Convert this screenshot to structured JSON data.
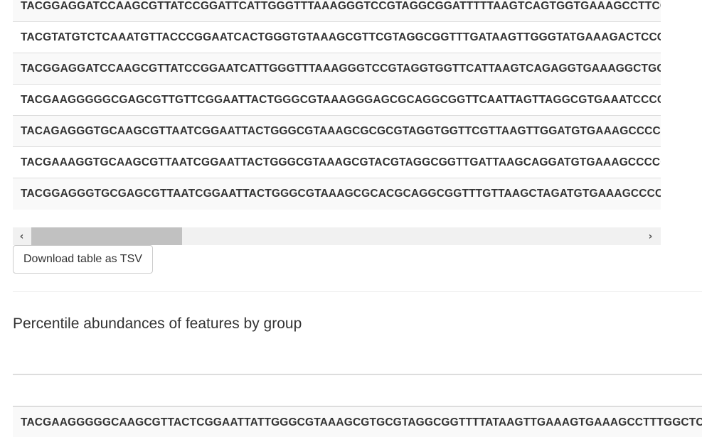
{
  "sequence_table": {
    "rows": [
      "TACGGAGGATCCAAGCGTTATCCGGATTCATTGGGTTTAAAGGGTCCGTAGGCGGATTTTTAAGTCAGTGGTGAAAGCCTTCCAGCTCAACTGAAACTATGCCTTTGATACTGG",
      "TACGTATGTCTCAAATGTTACCCGGAATCACTGGGTGTAAAGCGTTCGTAGGCGGTTTGATAAGTTGGGTATGAAAGACTCCGGCTCAACCGGAGGAGTGCCTTCAAAACTGT",
      "TACGGAGGATCCAAGCGTTATCCGGAATCATTGGGTTTAAAGGGTCCGTAGGTGGTTCATTAAGTCAGAGGTGAAAGGCTGCCGCTTAACGGTAGAATTGCCTTTGATACTGG",
      "TACGAAGGGGGCGAGCGTTGTTCGGAATTACTGGGCGTAAAGGGAGCGCAGGCGGTTCAATTAGTTAGGCGTGAAATCCCCGGGCTTAACCTGGGAACTGCGCTTAATACTGG",
      "TACAGAGGGTGCAAGCGTTAATCGGAATTACTGGGCGTAAAGCGCGCGTAGGTGGTTCGTTAAGTTGGATGTGAAAGCCCCGGGCTCAACCTGGGAACTGCATCCAAAACTGG",
      "TACGAAAGGTGCAAGCGTTAATCGGAATTACTGGGCGTAAAGCGTACGTAGGCGGTTGATTAAGCAGGATGTGAAAGCCCCGGGCTCAACCTGGGAACTGCATCTTGAACTGG",
      "TACGGAGGGTGCGAGCGTTAATCGGAATTACTGGGCGTAAAGCGCACGCAGGCGGTTTGTTAAGCTAGATGTGAAAGCCCCGGGCTCAACCTGGGAACTGCATTTAGAACTGG"
    ]
  },
  "download_button": {
    "label": "Download table as TSV"
  },
  "section": {
    "title": "Percentile abundances of features by group"
  },
  "percentile_table": {
    "rows": [
      "TACGAAGGGGGCAAGCGTTACTCGGAATTATTGGGCGTAAAGCGTGCGTAGGCGGTTTTATAAGTTGAAAGTGAAAGCCTTTGGCTCAACCAAAGAATTGCTTTCAAAACTGG"
    ]
  },
  "scrollbar": {
    "left_icon": "chevron-left-icon",
    "right_icon": "chevron-right-icon"
  },
  "colors": {
    "stripe": "#f9f9f9",
    "border": "#dddddd",
    "scroll_track": "#f1f1f1",
    "scroll_thumb": "#c1c1c1"
  }
}
